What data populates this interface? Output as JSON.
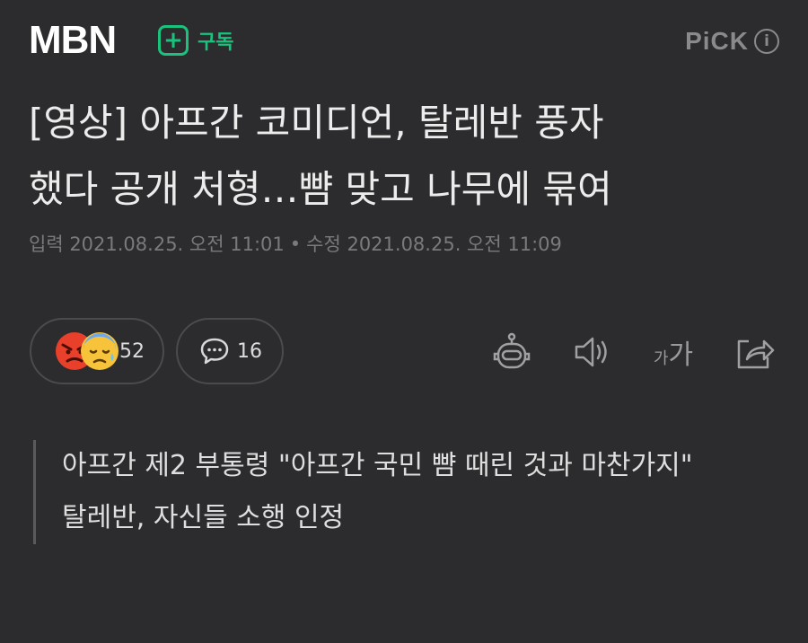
{
  "header": {
    "logo": "MBN",
    "subscribe_icon": "+",
    "subscribe_label": "구독",
    "pick_label": "PiCK",
    "info_icon": "i"
  },
  "article": {
    "title_lines": [
      "[영상] 아프간 코미디언, 탈레반 풍자",
      "했다 공개 처형…뺨 맞고 나무에 묶여"
    ],
    "published": "입력 2021.08.25. 오전 11:01",
    "separator": "•",
    "modified": "수정 2021.08.25. 오전 11:09",
    "summary": [
      "아프간 제2 부통령 \"아프간 국민 뺨 때린 것과 마찬가지\"",
      "탈레반, 자신들 소행 인정"
    ]
  },
  "reactions": {
    "emoji_icons": [
      "angry-face-icon",
      "sad-sweat-face-icon"
    ],
    "count": "52"
  },
  "comments": {
    "icon": "speech-bubble-icon",
    "count": "16"
  },
  "toolbar": {
    "icons": [
      "robot-icon",
      "speaker-icon",
      "font-size-icon",
      "share-icon"
    ],
    "font_size_small": "가",
    "font_size_large": "가"
  },
  "colors": {
    "background": "#2c2c2e",
    "accent_green": "#19c37d",
    "angry_red": "#e8402a",
    "emoji_yellow": "#f7c33b",
    "muted": "#7a7a7d"
  }
}
